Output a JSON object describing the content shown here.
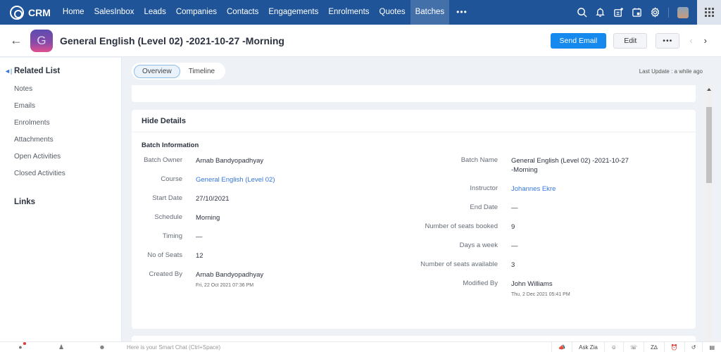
{
  "topnav": {
    "brand": "CRM",
    "items": [
      "Home",
      "SalesInbox",
      "Leads",
      "Companies",
      "Contacts",
      "Engagements",
      "Enrolments",
      "Quotes",
      "Batches"
    ],
    "active": "Batches",
    "more": "•••",
    "icons": [
      "search-icon",
      "bell-icon",
      "add-note-icon",
      "calendar-icon",
      "gear-icon"
    ]
  },
  "record": {
    "avatar_letter": "G",
    "title": "General English (Level 02) -2021-10-27 -Morning",
    "send_email": "Send Email",
    "edit": "Edit",
    "more": "•••"
  },
  "sidebar": {
    "related_list_title": "Related List",
    "items": [
      "Notes",
      "Emails",
      "Enrolments",
      "Attachments",
      "Open Activities",
      "Closed Activities"
    ],
    "links_title": "Links"
  },
  "tabs": {
    "items": [
      "Overview",
      "Timeline"
    ],
    "active": "Overview",
    "last_update": "Last Update : a while ago"
  },
  "details": {
    "toggle_label": "Hide Details",
    "section_title": "Batch Information",
    "left": [
      {
        "label": "Batch Owner",
        "value": "Arnab Bandyopadhyay"
      },
      {
        "label": "Course",
        "value": "General English (Level 02)",
        "link": true
      },
      {
        "label": "Start Date",
        "value": "27/10/2021"
      },
      {
        "label": "Schedule",
        "value": "Morning"
      },
      {
        "label": "Timing",
        "value": "—"
      },
      {
        "label": "No of Seats",
        "value": "12"
      },
      {
        "label": "Created By",
        "value": "Arnab Bandyopadhyay",
        "sub": "Fri, 22 Oct 2021 07:36 PM"
      }
    ],
    "right": [
      {
        "label": "Batch Name",
        "value": "General English (Level 02) -2021-10-27 -Morning"
      },
      {
        "label": "Instructor",
        "value": "Johannes Ekre",
        "link": true
      },
      {
        "label": "End Date",
        "value": "—"
      },
      {
        "label": "Number of seats booked",
        "value": "9"
      },
      {
        "label": "Days a week",
        "value": "—"
      },
      {
        "label": "Number of seats available",
        "value": "3"
      },
      {
        "label": "Modified By",
        "value": "John Williams",
        "sub": "Thu, 2 Dec 2021 05:41 PM"
      }
    ]
  },
  "bottombar": {
    "smart_chat_placeholder": "Here is your Smart Chat (Ctrl+Space)",
    "ask_zia": "Ask Zia"
  },
  "colors": {
    "nav_bg": "#1f5498",
    "nav_active": "#4470aa",
    "primary": "#1589ee",
    "link": "#3477db"
  }
}
